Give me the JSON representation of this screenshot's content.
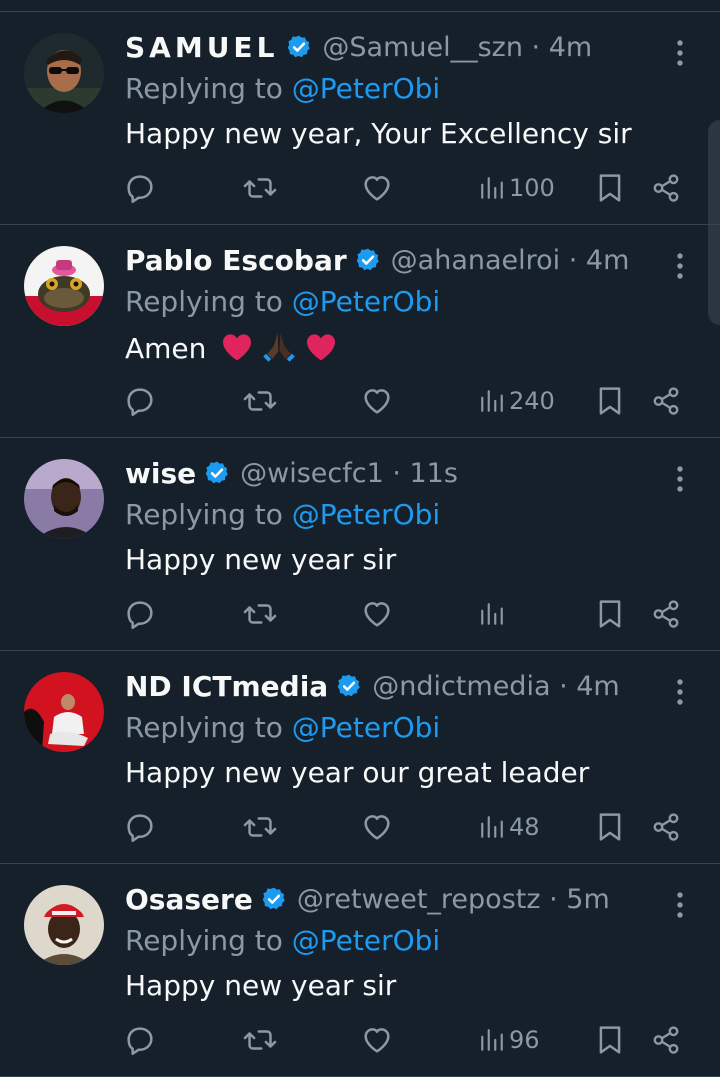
{
  "colors": {
    "background": "#15202b",
    "text": "#f7f9f9",
    "muted": "#8b98a5",
    "link": "#1d9bf0",
    "divider": "#38444d"
  },
  "tweets": [
    {
      "name": "SAMUEL",
      "handle_time": "@Samuel__szn · 4m",
      "replying_prefix": "Replying to ",
      "replying_to": "@PeterObi",
      "text": "Happy new year, Your Excellency sir",
      "views": "100",
      "avatar": "sunglasses-man-avatar"
    },
    {
      "name": "Pablo Escobar",
      "handle_time": "@ahanaelroi · 4m",
      "replying_prefix": "Replying to ",
      "replying_to": "@PeterObi",
      "text": "Amen",
      "views": "240",
      "avatar": "frog-avatar"
    },
    {
      "name": "wise",
      "handle_time": "@wisecfc1 · 11s",
      "replying_prefix": "Replying to ",
      "replying_to": "@PeterObi",
      "text": "Happy new year sir",
      "views": "",
      "avatar": "man-purple-bg-avatar"
    },
    {
      "name": "ND ICTmedia",
      "handle_time": "@ndictmedia · 4m",
      "replying_prefix": "Replying to ",
      "replying_to": "@PeterObi",
      "text": "Happy new year our great leader",
      "views": "48",
      "avatar": "woman-red-bg-avatar"
    },
    {
      "name": "Osasere",
      "handle_time": "@retweet_repostz · 5m",
      "replying_prefix": "Replying to ",
      "replying_to": "@PeterObi",
      "text": "Happy new year sir",
      "views": "96",
      "avatar": "red-cap-man-avatar"
    }
  ]
}
